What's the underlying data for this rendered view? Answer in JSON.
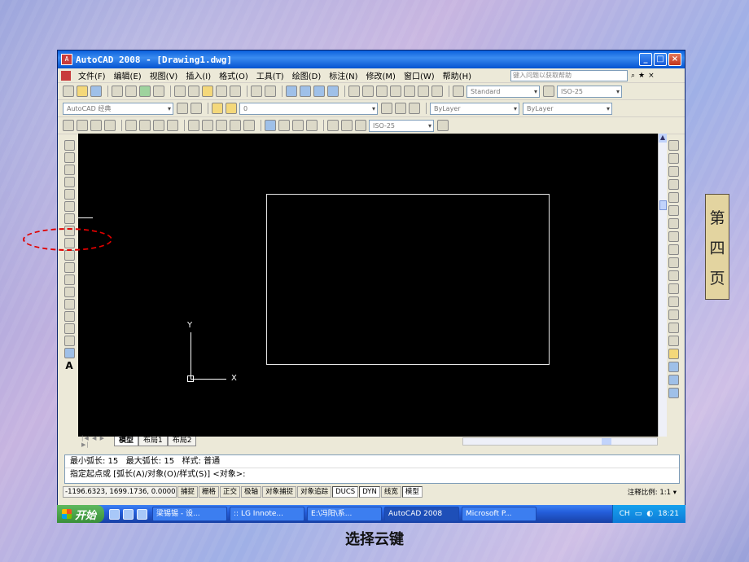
{
  "window": {
    "title": "AutoCAD 2008 - [Drawing1.dwg]",
    "app_icon": "A",
    "min": "_",
    "max": "□",
    "close": "×"
  },
  "menu": {
    "items": [
      "文件(F)",
      "编辑(E)",
      "视图(V)",
      "插入(I)",
      "格式(O)",
      "工具(T)",
      "绘图(D)",
      "标注(N)",
      "修改(M)",
      "窗口(W)",
      "帮助(H)"
    ],
    "help_placeholder": "键入问题以获取帮助"
  },
  "toolbars": {
    "text_style": "Standard",
    "dim_style": "ISO-25",
    "workspace": "AutoCAD 经典",
    "layer": "0",
    "color": "ByLayer",
    "linetype": "ByLayer",
    "dim_style2": "ISO-25"
  },
  "drawing": {
    "ucs_y": "Y",
    "ucs_x": "X"
  },
  "tabs": {
    "nav": "|◀ ◀ ▶ ▶|",
    "items": [
      "模型",
      "布局1",
      "布局2"
    ]
  },
  "command": {
    "line1": "最小弧长: 15   最大弧长: 15   样式: 普通",
    "line2": "指定起点或 [弧长(A)/对象(O)/样式(S)] <对象>:"
  },
  "status": {
    "coords": "-1196.6323, 1699.1736, 0.0000",
    "buttons": [
      "捕捉",
      "栅格",
      "正交",
      "极轴",
      "对象捕捉",
      "对象追踪",
      "DUCS",
      "DYN",
      "线宽",
      "模型"
    ],
    "annotation_scale": "注释比例: 1:1 ▾"
  },
  "taskbar": {
    "start": "开始",
    "tasks": [
      "梁锡锡 - 设...",
      ":: LG Innote...",
      "E:\\冯阳\\系...",
      "AutoCAD 2008",
      "Microsoft P..."
    ],
    "lang": "CH",
    "clock": "18:21"
  },
  "slide": {
    "page_chars": [
      "第",
      "四",
      "页"
    ],
    "caption": "选择云键"
  },
  "colors": {
    "canvas": "#000000",
    "highlight": "#e00000",
    "title_bar": "#0a5fdc"
  }
}
